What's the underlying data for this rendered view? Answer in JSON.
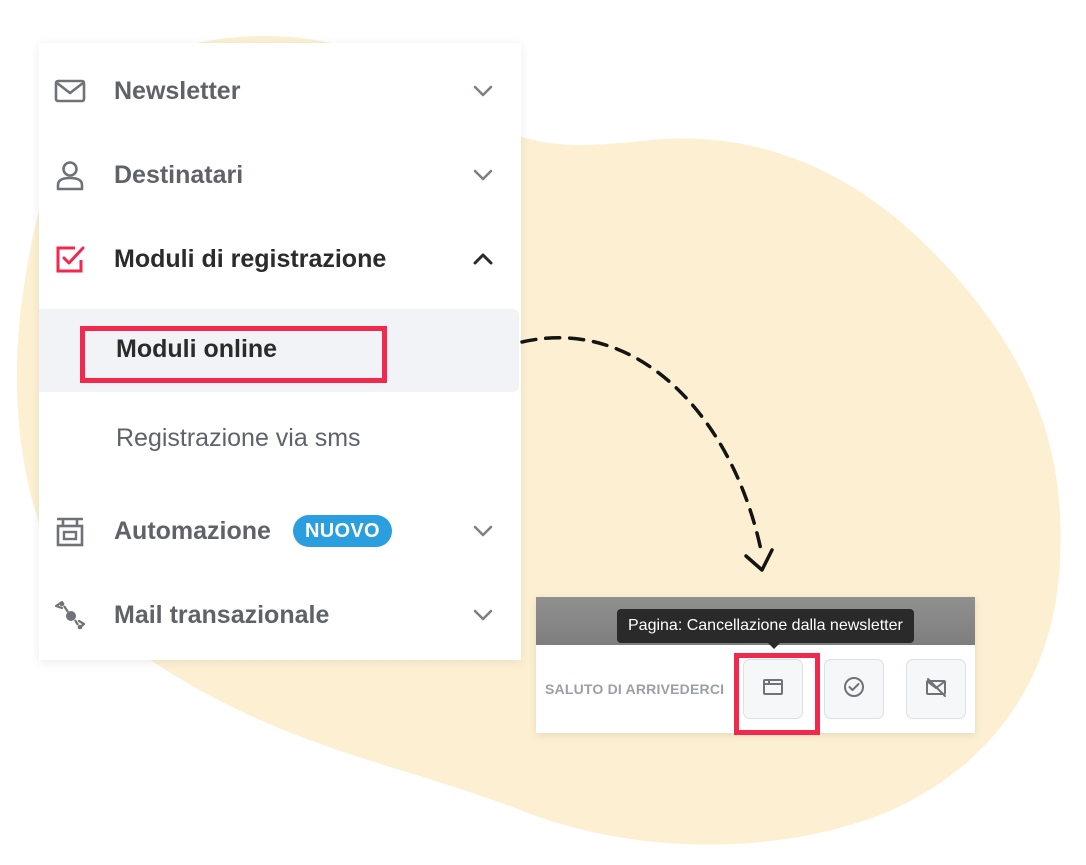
{
  "menu": {
    "items": [
      {
        "label": "Newsletter",
        "icon": "mail-icon",
        "chevron": "chevron-down-icon"
      },
      {
        "label": "Destinatari",
        "icon": "user-icon",
        "chevron": "chevron-down-icon"
      },
      {
        "label": "Moduli di registrazione",
        "icon": "form-check-icon",
        "chevron": "chevron-up-icon"
      },
      {
        "label": "Automazione",
        "icon": "automation-icon",
        "chevron": "chevron-down-icon",
        "badge": "NUOVO"
      },
      {
        "label": "Mail transazionale",
        "icon": "transactional-icon",
        "chevron": "chevron-down-icon"
      }
    ],
    "submenu": {
      "online": "Moduli online",
      "sms": "Registrazione via sms"
    }
  },
  "panel": {
    "tooltip": "Pagina: Cancellazione dalla newsletter",
    "section_label": "SALUTO DI ARRIVEDERCI",
    "buttons": [
      "page-icon",
      "check-circle-icon",
      "no-mail-icon"
    ]
  },
  "colors": {
    "accent_red": "#f2284d",
    "badge_blue": "#2b9ee0",
    "blob_yellow": "#fdf0d2",
    "menu_text": "#5f6368",
    "active_text": "#2b2b2b"
  }
}
